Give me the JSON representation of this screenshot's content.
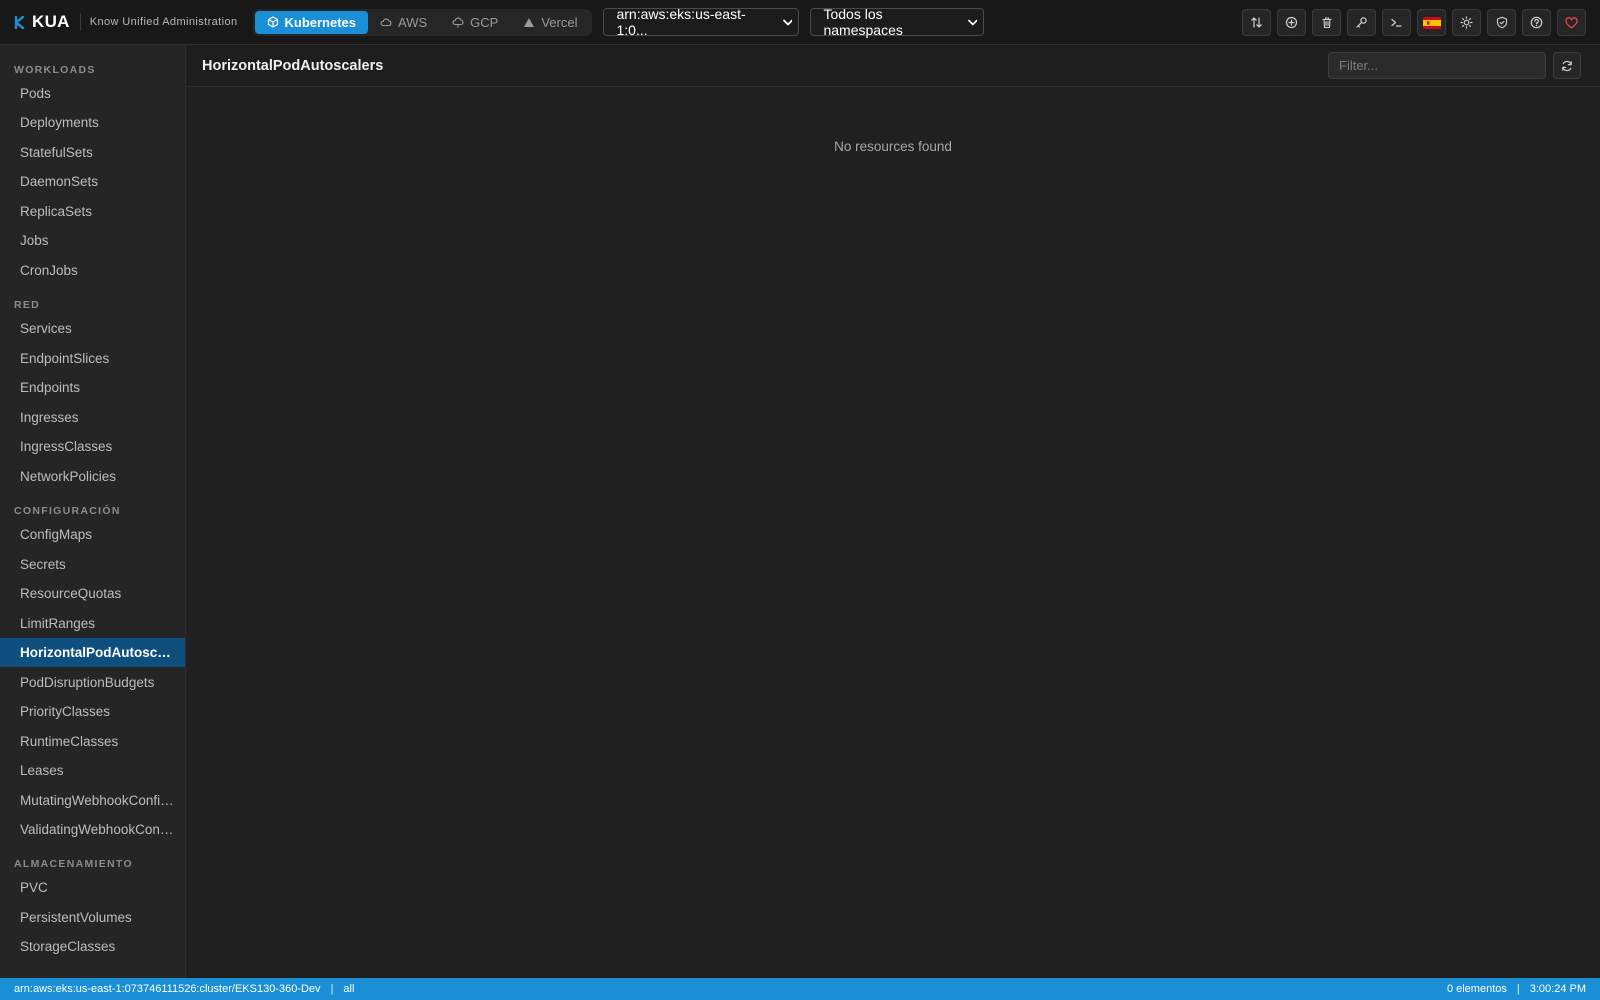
{
  "app": {
    "name": "KUA",
    "subtitle": "Know Unified Administration"
  },
  "cloud_tabs": [
    {
      "label": "Kubernetes",
      "icon": "cube-icon",
      "active": true
    },
    {
      "label": "AWS",
      "icon": "cloud-icon",
      "active": false
    },
    {
      "label": "GCP",
      "icon": "gcp-cloud-icon",
      "active": false
    },
    {
      "label": "Vercel",
      "icon": "triangle-icon",
      "active": false
    }
  ],
  "context_select": {
    "value": "arn:aws:eks:us-east-1:0..."
  },
  "namespace_select": {
    "value": "Todos los namespaces"
  },
  "toolbar": {
    "icons": [
      "port-forward-icon",
      "add-icon",
      "trash-icon",
      "key-icon",
      "terminal-icon",
      "spain-flag-icon",
      "sun-icon",
      "shield-icon",
      "help-icon",
      "heart-icon"
    ],
    "accent": "#1a8fd6",
    "heart_color": "#e0474c"
  },
  "sidebar": {
    "sections": [
      {
        "title": "WORKLOADS",
        "items": [
          "Pods",
          "Deployments",
          "StatefulSets",
          "DaemonSets",
          "ReplicaSets",
          "Jobs",
          "CronJobs"
        ]
      },
      {
        "title": "RED",
        "items": [
          "Services",
          "EndpointSlices",
          "Endpoints",
          "Ingresses",
          "IngressClasses",
          "NetworkPolicies"
        ]
      },
      {
        "title": "CONFIGURACIÓN",
        "items": [
          "ConfigMaps",
          "Secrets",
          "ResourceQuotas",
          "LimitRanges",
          "HorizontalPodAutoscalers",
          "PodDisruptionBudgets",
          "PriorityClasses",
          "RuntimeClasses",
          "Leases",
          "MutatingWebhookConfigurations",
          "ValidatingWebhookConfigurations"
        ]
      },
      {
        "title": "ALMACENAMIENTO",
        "items": [
          "PVC",
          "PersistentVolumes",
          "StorageClasses"
        ]
      }
    ],
    "active_item": "HorizontalPodAutoscalers",
    "active_color": "#0e4f7d"
  },
  "main": {
    "title": "HorizontalPodAutoscalers",
    "filter_placeholder": "Filter...",
    "empty_message": "No resources found"
  },
  "statusbar": {
    "context": "arn:aws:eks:us-east-1:073746111526:cluster/EKS130-360-Dev",
    "namespace": "all",
    "count": "0 elementos",
    "time": "3:00:24 PM"
  }
}
